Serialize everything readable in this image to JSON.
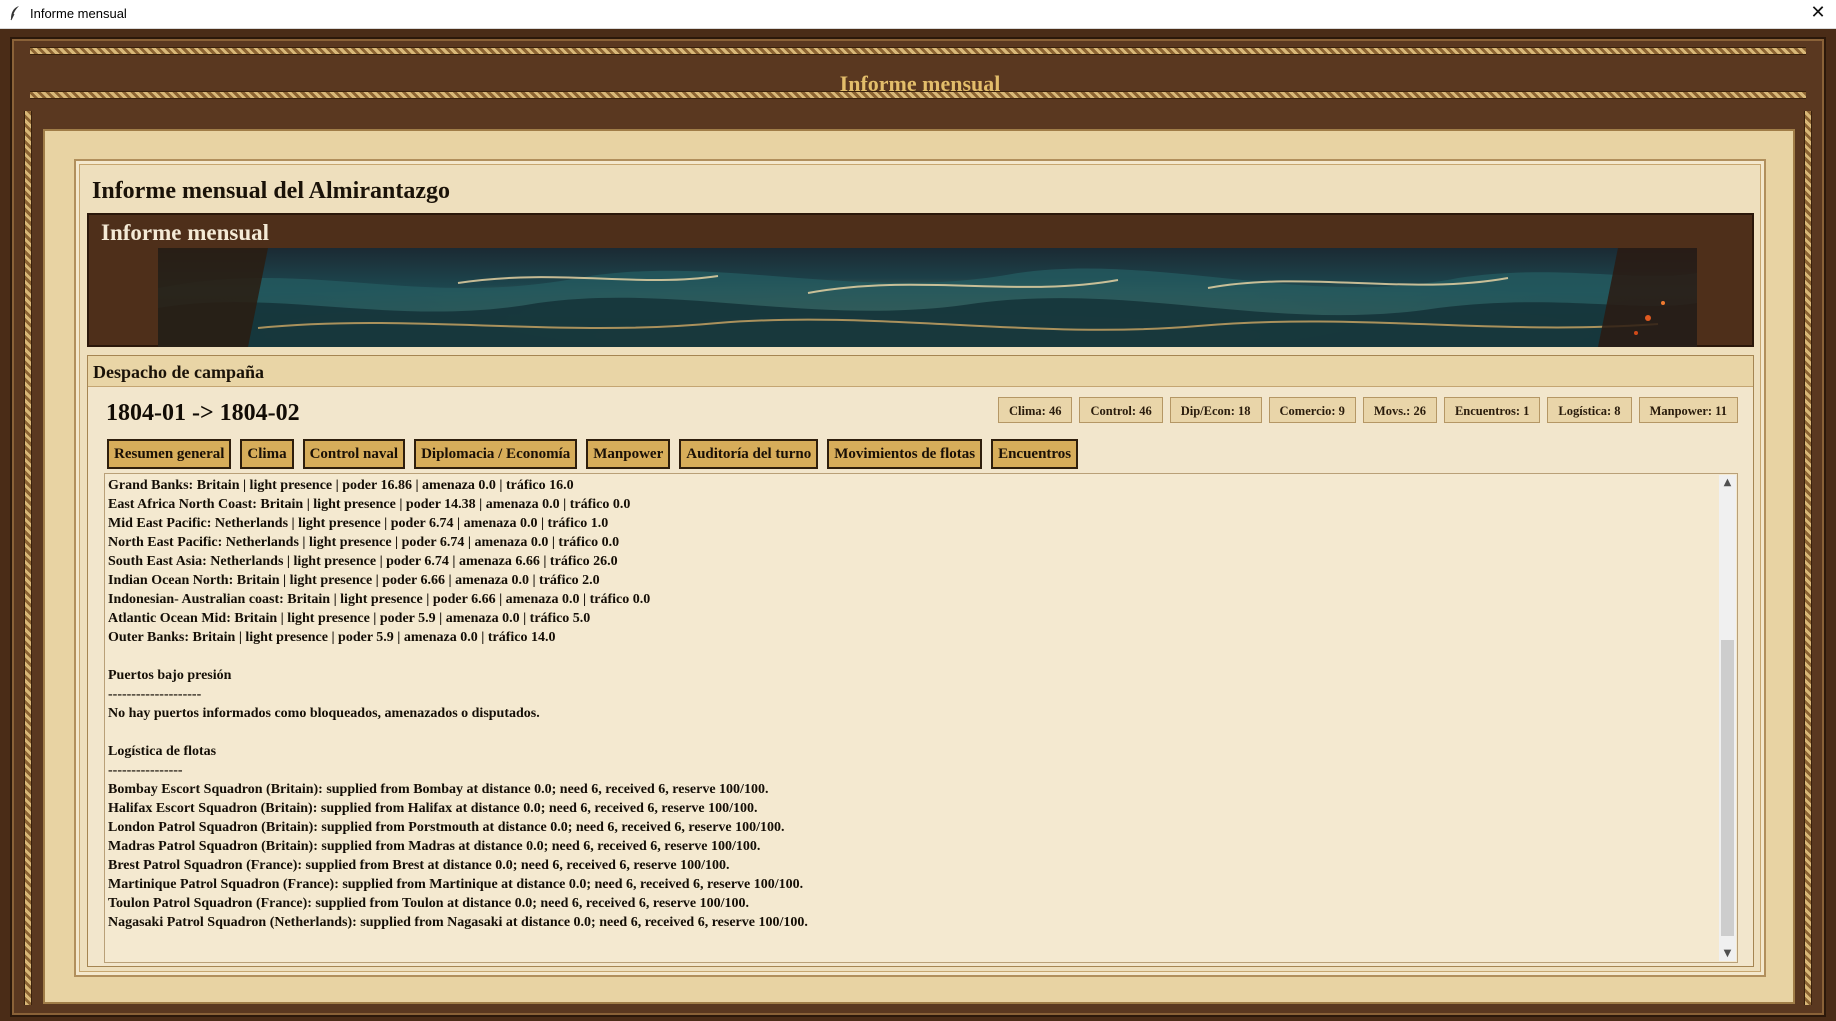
{
  "window": {
    "title": "Informe mensual",
    "close_glyph": "✕"
  },
  "header": {
    "title": "Informe mensual"
  },
  "report_window": {
    "main_title": "Informe mensual del Almirantazgo",
    "banner_label": "Informe mensual",
    "dispatch_label": "Despacho de campaña",
    "period": "1804-01 -> 1804-02"
  },
  "stats": [
    "Clima: 46",
    "Control: 46",
    "Dip/Econ: 18",
    "Comercio: 9",
    "Movs.: 26",
    "Encuentros: 1",
    "Logística: 8",
    "Manpower: 11"
  ],
  "tabs": [
    "Resumen general",
    "Clima",
    "Control naval",
    "Diplomacia / Economía",
    "Manpower",
    "Auditoría del turno",
    "Movimientos de flotas",
    "Encuentros"
  ],
  "report_lines": [
    "Grand Banks: Britain | light presence | poder 16.86 | amenaza 0.0 | tráfico 16.0",
    "East Africa North Coast: Britain | light presence | poder 14.38 | amenaza 0.0 | tráfico 0.0",
    "Mid East Pacific: Netherlands | light presence | poder 6.74 | amenaza 0.0 | tráfico 1.0",
    "North East Pacific: Netherlands | light presence | poder 6.74 | amenaza 0.0 | tráfico 0.0",
    "South East Asia: Netherlands | light presence | poder 6.74 | amenaza 6.66 | tráfico 26.0",
    "Indian Ocean North: Britain | light presence | poder 6.66 | amenaza 0.0 | tráfico 2.0",
    "Indonesian- Australian coast: Britain | light presence | poder 6.66 | amenaza 0.0 | tráfico 0.0",
    "Atlantic Ocean Mid: Britain | light presence | poder 5.9 | amenaza 0.0 | tráfico 5.0",
    "Outer Banks: Britain | light presence | poder 5.9 | amenaza 0.0 | tráfico 14.0",
    "",
    "Puertos bajo presión",
    "--------------------",
    "No hay puertos informados como bloqueados, amenazados o disputados.",
    "",
    "Logística de flotas",
    "----------------",
    "Bombay Escort Squadron (Britain): supplied from Bombay at distance 0.0; need 6, received 6, reserve 100/100.",
    "Halifax Escort Squadron (Britain): supplied from Halifax at distance 0.0; need 6, received 6, reserve 100/100.",
    "London Patrol Squadron (Britain): supplied from Porstmouth at distance 0.0; need 6, received 6, reserve 100/100.",
    "Madras Patrol Squadron (Britain): supplied from Madras at distance 0.0; need 6, received 6, reserve 100/100.",
    "Brest Patrol Squadron (France): supplied from Brest at distance 0.0; need 6, received 6, reserve 100/100.",
    "Martinique Patrol Squadron (France): supplied from Martinique at distance 0.0; need 6, received 6, reserve 100/100.",
    "Toulon Patrol Squadron (France): supplied from Toulon at distance 0.0; need 6, received 6, reserve 100/100.",
    "Nagasaki Patrol Squadron (Netherlands): supplied from Nagasaki at distance 0.0; need 6, received 6, reserve 100/100."
  ],
  "scrollbar": {
    "up_glyph": "▲",
    "down_glyph": "▼",
    "position_fraction": 0.6
  },
  "icons": {
    "app": "feather-icon",
    "close": "close-icon",
    "banner": "stormy-sea-banner"
  }
}
